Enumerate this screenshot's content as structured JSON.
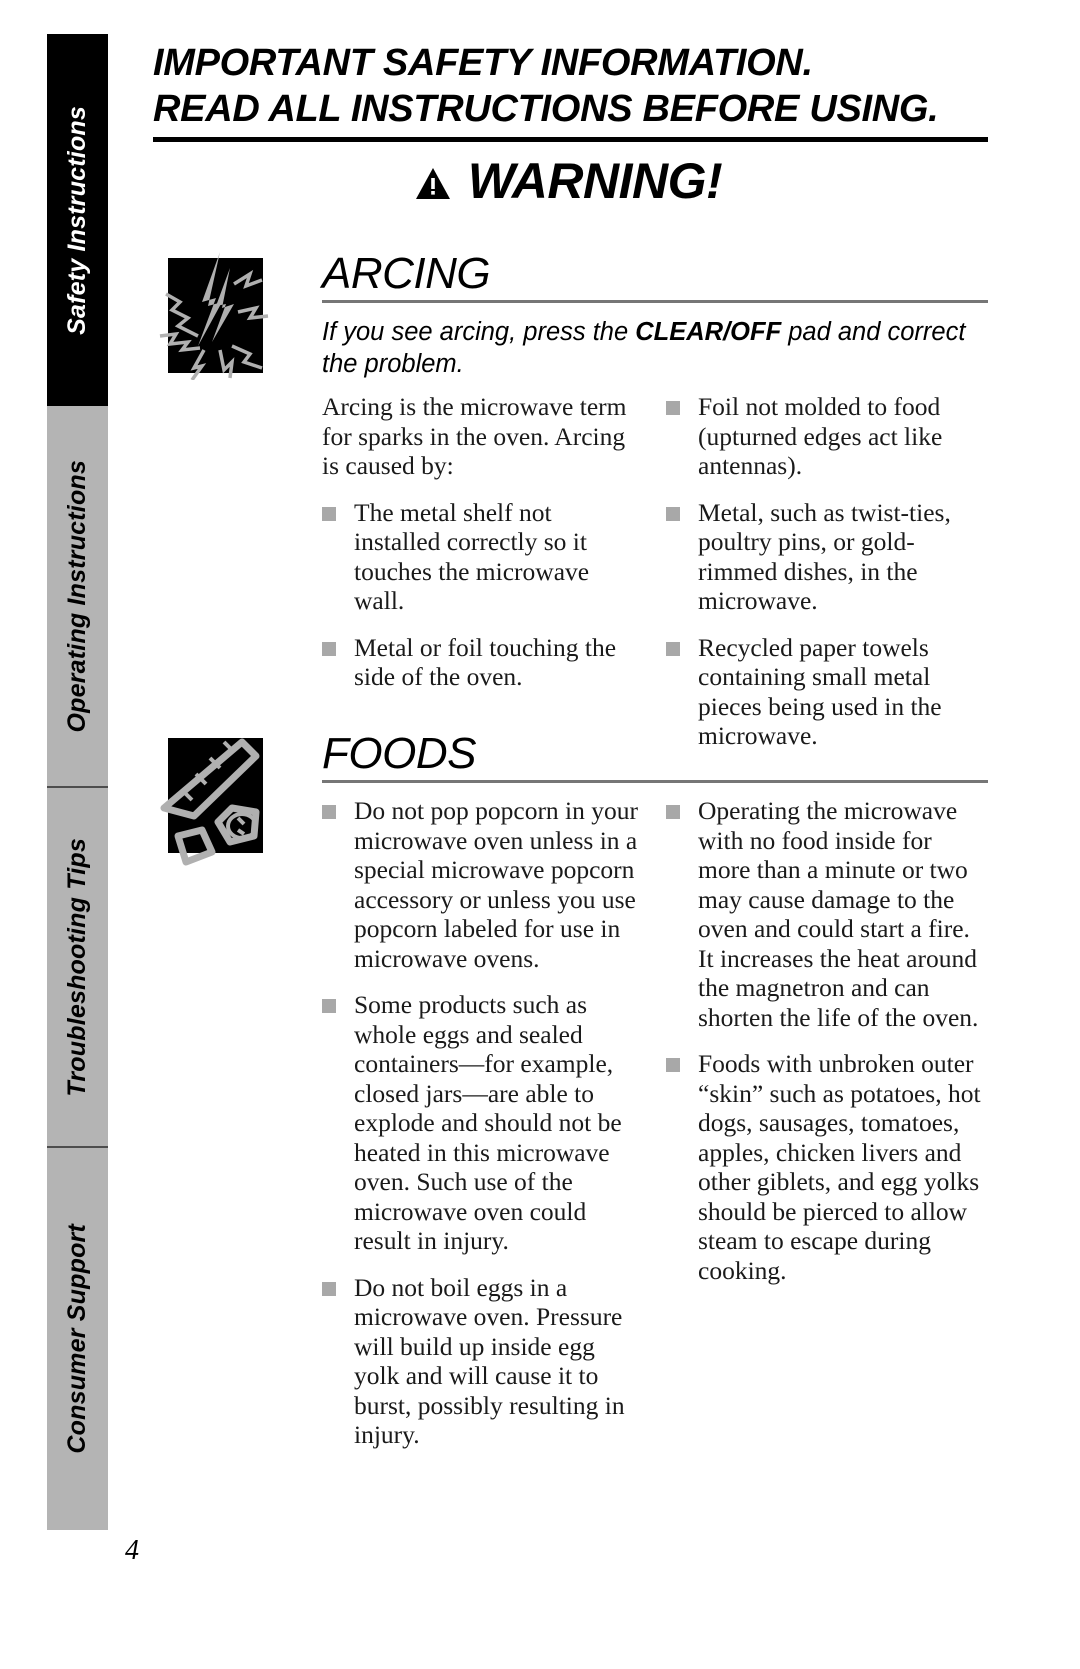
{
  "sidebar": {
    "tabs": [
      {
        "label": "Safety Instructions",
        "active": true
      },
      {
        "label": "Operating Instructions",
        "active": false
      },
      {
        "label": "Troubleshooting Tips",
        "active": false
      },
      {
        "label": "Consumer Support",
        "active": false
      }
    ]
  },
  "header": {
    "line1": "IMPORTANT SAFETY INFORMATION.",
    "line2": "READ ALL INSTRUCTIONS BEFORE USING."
  },
  "warning": {
    "icon": "warning-triangle-icon",
    "text": "WARNING!"
  },
  "sections": [
    {
      "id": "arcing",
      "title": "ARCING",
      "icon": "arcing-sparks-icon",
      "lead_before": "If you see arcing, press the ",
      "lead_bold": "CLEAR/OFF",
      "lead_after": " pad and correct the problem.",
      "left_column": {
        "intro": "Arcing is the microwave term for sparks in the oven. Arcing is caused by:",
        "bullets": [
          "The metal shelf not installed correctly so it touches the microwave wall.",
          "Metal or foil touching the side of the oven."
        ]
      },
      "right_column": {
        "bullets": [
          "Foil not molded to food (upturned edges act like antennas).",
          "Metal, such as twist-ties, poultry pins, or gold-rimmed dishes, in the microwave.",
          "Recycled paper towels containing small metal pieces being used in the microwave."
        ]
      }
    },
    {
      "id": "foods",
      "title": "FOODS",
      "icon": "foods-corn-icon",
      "left_column": {
        "bullets": [
          "Do not pop popcorn in your microwave oven unless in a special microwave popcorn accessory or unless you use popcorn labeled for use in microwave ovens.",
          "Some products such as whole eggs and sealed containers—for example, closed jars—are able to explode and should not be heated in this microwave oven. Such use of the microwave oven could result in injury.",
          "Do not boil eggs in a microwave oven. Pressure will build up inside egg yolk and will cause it to burst, possibly resulting in injury."
        ]
      },
      "right_column": {
        "bullets": [
          "Operating the microwave with no food inside for more than a minute or two may cause damage to the oven and could start a fire. It increases the heat around the magnetron and can shorten the life of the oven.",
          "Foods with unbroken outer “skin” such as potatoes, hot dogs, sausages, tomatoes, apples, chicken livers and other giblets, and egg yolks should be pierced to allow steam to escape during cooking."
        ]
      }
    }
  ],
  "footer": {
    "page_number": "4"
  },
  "colors": {
    "tab_active_bg": "#000000",
    "tab_inactive_bg": "#b4b4b4",
    "bullet": "#a8a8a8",
    "rule": "#767676",
    "icon_box": "#000000",
    "icon_art": "#b0b0b0"
  }
}
